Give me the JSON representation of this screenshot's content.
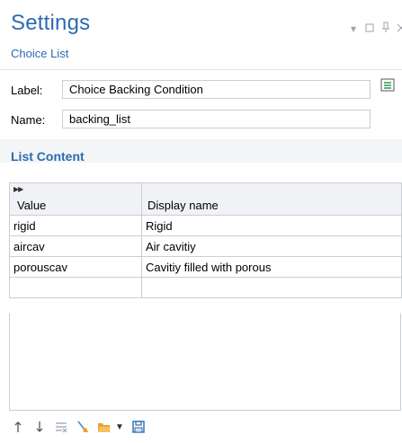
{
  "header": {
    "title": "Settings",
    "subtitle": "Choice List"
  },
  "form": {
    "label_caption": "Label:",
    "label_value": "Choice Backing Condition",
    "name_caption": "Name:",
    "name_value": "backing_list"
  },
  "section": {
    "title": "List Content"
  },
  "table": {
    "headers": [
      "Value",
      "Display name"
    ],
    "rows": [
      [
        "rigid",
        "Rigid"
      ],
      [
        "aircav",
        "Air cavitiy"
      ],
      [
        "porouscav",
        "Cavitiy filled with porous"
      ]
    ]
  },
  "toolbar": {
    "icons": [
      "move-up-icon",
      "move-down-icon",
      "delete-rows-icon",
      "clear-icon",
      "open-file-icon",
      "save-icon"
    ]
  },
  "colors": {
    "accent": "#2c6bb0",
    "folder": "#f0a030",
    "save": "#2c6bb0"
  }
}
